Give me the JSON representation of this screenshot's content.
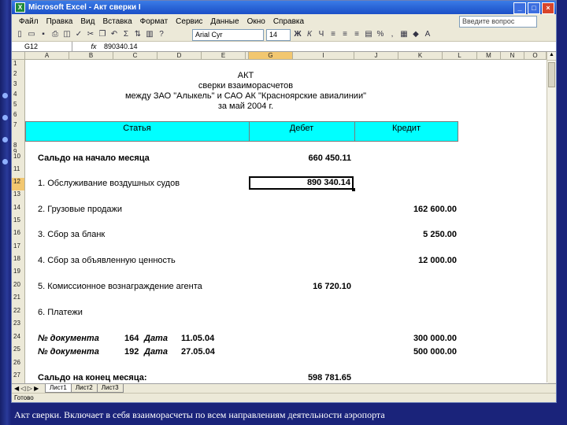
{
  "window": {
    "title": "Microsoft Excel - Акт сверки I",
    "app_badge": "X"
  },
  "menu": [
    "Файл",
    "Правка",
    "Вид",
    "Вставка",
    "Формат",
    "Сервис",
    "Данные",
    "Окно",
    "Справка"
  ],
  "question_box": "Введите вопрос",
  "toolbar": {
    "font": "Arial Cyr",
    "size": "14",
    "zoom": "100%"
  },
  "formula_bar": {
    "name_box": "G12",
    "fx": "fx",
    "value": "890340.14"
  },
  "columns": [
    "A",
    "B",
    "C",
    "D",
    "E",
    "F",
    "G",
    "I",
    "J",
    "K",
    "L",
    "M",
    "N",
    "O"
  ],
  "rows": [
    "1",
    "2",
    "3",
    "4",
    "5",
    "6",
    "7",
    "8",
    "9",
    "10",
    "11",
    "12",
    "13",
    "14",
    "15",
    "16",
    "17",
    "18",
    "19",
    "20",
    "21",
    "22",
    "23",
    "24",
    "25",
    "26",
    "27"
  ],
  "act": {
    "title": "АКТ",
    "line2": "сверки взаиморасчетов",
    "line3": "между ЗАО \"Алыкель\" и САО АК \"Красноярские авиалинии\"",
    "line4": "за май 2004 г."
  },
  "header": {
    "article": "Статья",
    "debit": "Дебет",
    "credit": "Кредит"
  },
  "lines": [
    {
      "row": "10",
      "label": "Сальдо на начало месяца",
      "debit": "660 450.11",
      "credit": ""
    },
    {
      "row": "12",
      "label": "1. Обслуживание воздушных судов",
      "debit": "890 340.14",
      "credit": ""
    },
    {
      "row": "14",
      "label": "2. Грузовые продажи",
      "debit": "",
      "credit": "162 600.00"
    },
    {
      "row": "16",
      "label": "3. Сбор за бланк",
      "debit": "",
      "credit": "5 250.00"
    },
    {
      "row": "18",
      "label": "4. Сбор за объявленную ценность",
      "debit": "",
      "credit": "12 000.00"
    },
    {
      "row": "20",
      "label": "5. Комиссионное вознаграждение агента",
      "debit": "16 720.10",
      "credit": ""
    },
    {
      "row": "22",
      "label": "6. Платежи",
      "debit": "",
      "credit": ""
    }
  ],
  "payments": [
    {
      "doc_label": "№ документа",
      "doc_no": "164",
      "date_label": "Дата",
      "date": "11.05.04",
      "credit": "300 000.00"
    },
    {
      "doc_label": "№ документа",
      "doc_no": "192",
      "date_label": "Дата",
      "date": "27.05.04",
      "credit": "500 000.00"
    }
  ],
  "closing": {
    "label": "Сальдо на конец месяца:",
    "debit": "598 781.65"
  },
  "sheet_tabs": [
    "Лист1",
    "Лист2",
    "Лист3"
  ],
  "status": "Готово",
  "caption": "Акт сверки. Включает в себя взаиморасчеты по всем направлениям деятельности аэропорта"
}
